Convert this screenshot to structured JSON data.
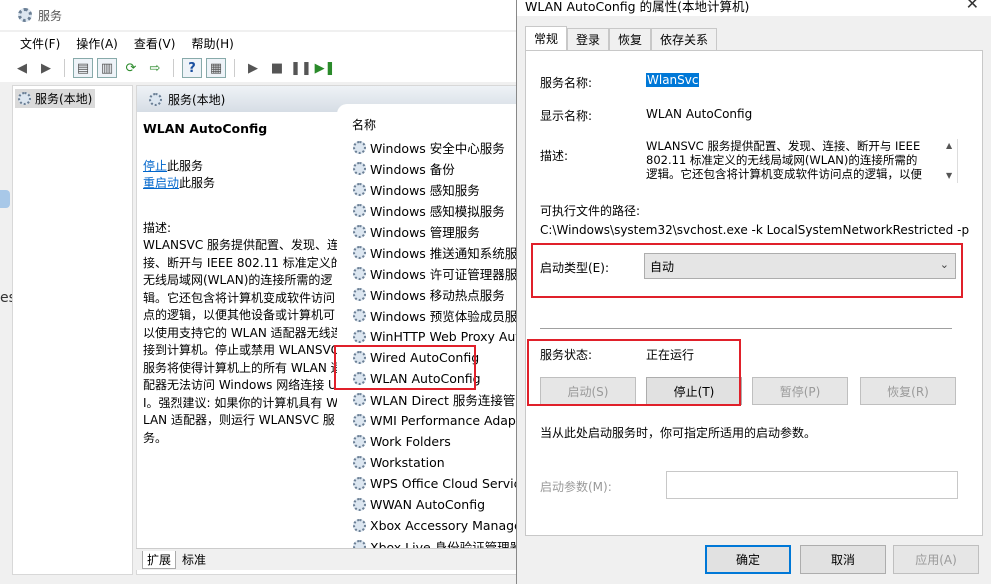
{
  "main_window": {
    "title": "服务",
    "menu": [
      "文件(F)",
      "操作(A)",
      "查看(V)",
      "帮助(H)"
    ],
    "tree_root": "服务(本地)",
    "content_header": "服务(本地)",
    "selected_service_name": "WLAN AutoConfig",
    "stop_link": "停止",
    "stop_suffix": "此服务",
    "restart_link": "重启动",
    "restart_suffix": "此服务",
    "desc_label": "描述:",
    "desc_text": "WLANSVC 服务提供配置、发现、连接、断开与 IEEE 802.11 标准定义的无线局域网(WLAN)的连接所需的逻辑。它还包含将计算机变成软件访问点的逻辑，以便其他设备或计算机可以使用支持它的 WLAN 适配器无线连接到计算机。停止或禁用 WLANSVC 服务将使得计算机上的所有 WLAN 适配器无法访问 Windows 网络连接 UI。强烈建议: 如果你的计算机具有 WLAN 适配器，则运行 WLANSVC 服务。",
    "list_header": "名称",
    "services": [
      "Windows 安全中心服务",
      "Windows 备份",
      "Windows 感知服务",
      "Windows 感知模拟服务",
      "Windows 管理服务",
      "Windows 推送通知系统服务",
      "Windows 许可证管理器服务",
      "Windows 移动热点服务",
      "Windows 预览体验成员服务",
      "WinHTTP Web Proxy Auto",
      "Wired AutoConfig",
      "WLAN AutoConfig",
      "WLAN Direct 服务连接管",
      "WMI Performance Adapt",
      "Work Folders",
      "Workstation",
      "WPS Office Cloud Service",
      "WWAN AutoConfig",
      "Xbox Accessory Manage",
      "Xbox Live 身份验证管理器"
    ],
    "bottom_tabs": [
      "扩展",
      "标准"
    ],
    "left_edge_text": "es"
  },
  "dialog": {
    "title": "WLAN AutoConfig 的属性(本地计算机)",
    "tabs": [
      "常规",
      "登录",
      "恢复",
      "依存关系"
    ],
    "service_name_label": "服务名称:",
    "service_name_value": "WlanSvc",
    "display_name_label": "显示名称:",
    "display_name_value": "WLAN AutoConfig",
    "description_label": "描述:",
    "description_lines": [
      "WLANSVC 服务提供配置、发现、连接、断开与 IEEE",
      "802.11 标准定义的无线局域网(WLAN)的连接所需的",
      "逻辑。它还包含将计算机变成软件访问点的逻辑，以便"
    ],
    "path_label": "可执行文件的路径:",
    "path_value": "C:\\Windows\\system32\\svchost.exe -k LocalSystemNetworkRestricted -p",
    "startup_type_label": "启动类型(E):",
    "startup_type_value": "自动",
    "status_label": "服务状态:",
    "status_value": "正在运行",
    "start_button": "启动(S)",
    "stop_button": "停止(T)",
    "pause_button": "暂停(P)",
    "resume_button": "恢复(R)",
    "start_hint": "当从此处启动服务时，你可指定所适用的启动参数。",
    "params_label": "启动参数(M):",
    "params_value": "",
    "ok_button": "确定",
    "cancel_button": "取消",
    "apply_button": "应用(A)"
  },
  "colors": {
    "highlight_red": "#e0202a",
    "selection_blue": "#0078d7",
    "link_blue": "#0066cc"
  }
}
